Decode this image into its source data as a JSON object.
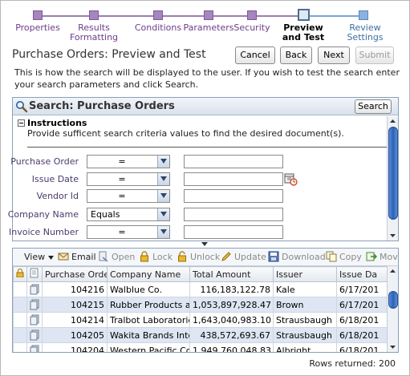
{
  "train": {
    "stops": [
      {
        "label": "Properties",
        "state": "visited"
      },
      {
        "label": "Results Formatting",
        "state": "visited"
      },
      {
        "label": "Conditions",
        "state": "visited"
      },
      {
        "label": "Parameters",
        "state": "visited"
      },
      {
        "label": "Security",
        "state": "visited"
      },
      {
        "label": "Preview and Test",
        "state": "current"
      },
      {
        "label": "Review Settings",
        "state": "future"
      }
    ]
  },
  "page": {
    "title": "Purchase Orders: Preview and Test",
    "intro": "This is how the search will be displayed to the user. If you wish to test the search enter your search parameters and click Search."
  },
  "buttons": {
    "cancel": "Cancel",
    "back": "Back",
    "next": "Next",
    "submit": "Submit"
  },
  "search": {
    "title": "Search: Purchase Orders",
    "button": "Search",
    "instructions_title": "Instructions",
    "instructions_text": "Provide sufficent search criteria values to find the desired document(s).",
    "fields": [
      {
        "label": "Purchase Order",
        "operator": "=",
        "value": ""
      },
      {
        "label": "Issue Date",
        "operator": "=",
        "value": ""
      },
      {
        "label": "Vendor Id",
        "operator": "=",
        "value": ""
      },
      {
        "label": "Company Name",
        "operator": "Equals",
        "value": ""
      },
      {
        "label": "Invoice Number",
        "operator": "=",
        "value": ""
      }
    ]
  },
  "toolbar": {
    "view": "View",
    "email": "Email",
    "open": "Open",
    "lock": "Lock",
    "unlock": "Unlock",
    "update": "Update",
    "download": "Download",
    "copy": "Copy",
    "move": "Move"
  },
  "table": {
    "columns": [
      "Purchase Order",
      "Company Name",
      "Total Amount",
      "Issuer",
      "Issue Date"
    ],
    "columns_visible": [
      "Purchase Order",
      "Company Name",
      "Total Amount",
      "Issuer",
      "Issue Da"
    ],
    "rows": [
      {
        "po": "104216",
        "company": "Walblue Co.",
        "amount": "116,183,122.78",
        "issuer": "Kale",
        "date": "6/17/201"
      },
      {
        "po": "104215",
        "company": "Rubber Products and",
        "amount": "1,053,897,928.47",
        "issuer": "Brown",
        "date": "6/17/201"
      },
      {
        "po": "104214",
        "company": "Tralbot Laboratories",
        "amount": "1,643,040,983.10",
        "issuer": "Strausbaugh",
        "date": "6/18/201"
      },
      {
        "po": "104205",
        "company": "Wakita Brands Intern",
        "amount": "438,572,693.67",
        "issuer": "Strausbaugh",
        "date": "6/18/201"
      },
      {
        "po": "104204",
        "company": "Western Pacific Corpo",
        "amount": "1,949,760,048.83",
        "issuer": "Albright",
        "date": "6/18/201"
      }
    ]
  },
  "footer": {
    "rows_returned": "Rows returned: 200"
  }
}
